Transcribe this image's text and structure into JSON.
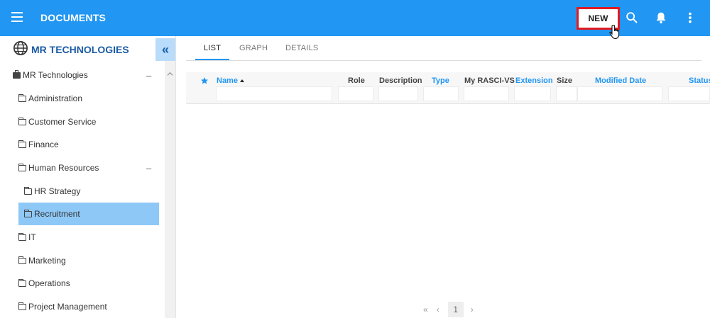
{
  "header": {
    "title": "DOCUMENTS",
    "new_label": "NEW",
    "accent_color": "#2196f3",
    "highlight_color": "#e01b24",
    "icons": [
      "menu-icon",
      "search-icon",
      "bell-icon",
      "more-vert-icon"
    ]
  },
  "sidebar": {
    "org_title": "MR TECHNOLOGIES",
    "collapse_symbol": "«",
    "items": [
      {
        "label": "MR Technologies",
        "icon": "briefcase-icon",
        "expanded": true
      },
      {
        "label": "Administration",
        "icon": "folder-icon"
      },
      {
        "label": "Customer Service",
        "icon": "folder-icon"
      },
      {
        "label": "Finance",
        "icon": "folder-icon"
      },
      {
        "label": "Human Resources",
        "icon": "folder-icon",
        "expanded": true
      },
      {
        "label": "HR Strategy",
        "icon": "folder-icon"
      },
      {
        "label": "Recruitment",
        "icon": "folder-icon",
        "selected": true
      },
      {
        "label": "IT",
        "icon": "folder-icon"
      },
      {
        "label": "Marketing",
        "icon": "folder-icon"
      },
      {
        "label": "Operations",
        "icon": "folder-icon"
      },
      {
        "label": "Project Management",
        "icon": "folder-icon"
      }
    ],
    "collapse_symbol_minus": "–"
  },
  "main": {
    "tabs": [
      {
        "label": "LIST",
        "active": true
      },
      {
        "label": "GRAPH"
      },
      {
        "label": "DETAILS"
      }
    ],
    "columns": [
      {
        "label": "Name",
        "sortable": true,
        "sorted": "asc"
      },
      {
        "label": "Role"
      },
      {
        "label": "Description"
      },
      {
        "label": "Type",
        "sortable": true
      },
      {
        "label": "My RASCI-VS"
      },
      {
        "label": "Extension",
        "sortable": true
      },
      {
        "label": "Size"
      },
      {
        "label": "Modified Date",
        "sortable": true
      },
      {
        "label": "Status",
        "sortable": true
      }
    ]
  },
  "pager": {
    "first": "«",
    "prev": "‹",
    "current_page": "1",
    "next": "›"
  }
}
